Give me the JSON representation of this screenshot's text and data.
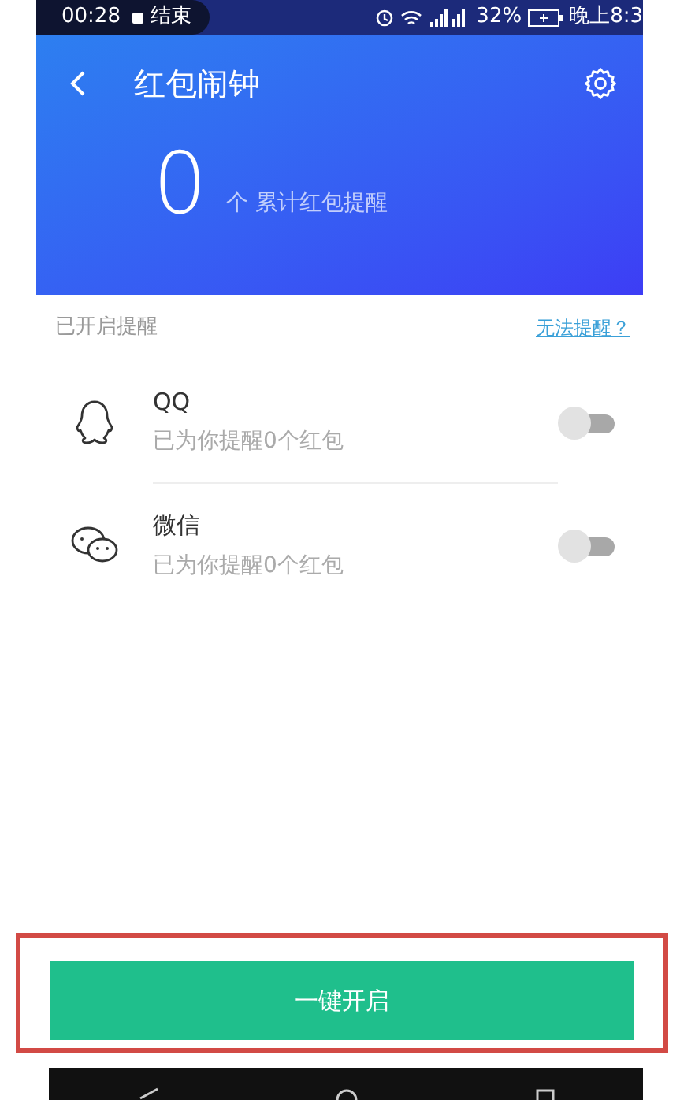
{
  "status_bar": {
    "call_time": "00:28",
    "call_action": "结束",
    "battery": "32%",
    "clock": "晚上8:3"
  },
  "header": {
    "title": "红包闹钟",
    "count": "0",
    "count_label": "个 累计红包提醒"
  },
  "section": {
    "title": "已开启提醒",
    "link": "无法提醒？"
  },
  "apps": [
    {
      "kind": "qq",
      "name": "QQ",
      "detail": "已为你提醒0个红包",
      "on": false
    },
    {
      "kind": "wechat",
      "name": "微信",
      "detail": "已为你提醒0个红包",
      "on": false
    }
  ],
  "action_button": {
    "label": "一键开启"
  }
}
